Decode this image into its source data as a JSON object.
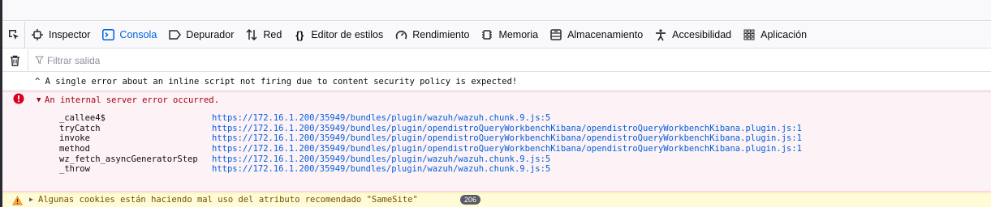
{
  "toolbar": {
    "tabs": [
      {
        "label": "Inspector",
        "icon": "inspector-icon"
      },
      {
        "label": "Consola",
        "icon": "console-icon",
        "active": true
      },
      {
        "label": "Depurador",
        "icon": "debugger-icon"
      },
      {
        "label": "Red",
        "icon": "network-icon"
      },
      {
        "label": "Editor de estilos",
        "icon": "style-editor-icon"
      },
      {
        "label": "Rendimiento",
        "icon": "performance-icon"
      },
      {
        "label": "Memoria",
        "icon": "memory-icon"
      },
      {
        "label": "Almacenamiento",
        "icon": "storage-icon"
      },
      {
        "label": "Accesibilidad",
        "icon": "accessibility-icon"
      },
      {
        "label": "Aplicación",
        "icon": "application-icon"
      }
    ],
    "active_color": "#0061e0"
  },
  "filter": {
    "placeholder": "Filtrar salida"
  },
  "messages": {
    "info": "^ A single error about an inline script not firing due to content security policy is expected!",
    "error": {
      "text": "An internal server error occurred.",
      "color": "#a4000f",
      "stack": [
        {
          "fn": "_callee4$",
          "loc": "https://172.16.1.200/35949/bundles/plugin/wazuh/wazuh.chunk.9.js:5"
        },
        {
          "fn": "tryCatch",
          "loc": "https://172.16.1.200/35949/bundles/plugin/opendistroQueryWorkbenchKibana/opendistroQueryWorkbenchKibana.plugin.js:1"
        },
        {
          "fn": "invoke",
          "loc": "https://172.16.1.200/35949/bundles/plugin/opendistroQueryWorkbenchKibana/opendistroQueryWorkbenchKibana.plugin.js:1"
        },
        {
          "fn": "method",
          "loc": "https://172.16.1.200/35949/bundles/plugin/opendistroQueryWorkbenchKibana/opendistroQueryWorkbenchKibana.plugin.js:1"
        },
        {
          "fn": "wz_fetch_asyncGeneratorStep",
          "loc": "https://172.16.1.200/35949/bundles/plugin/wazuh/wazuh.chunk.9.js:5"
        },
        {
          "fn": "_throw",
          "loc": "https://172.16.1.200/35949/bundles/plugin/wazuh/wazuh.chunk.9.js:5"
        }
      ]
    },
    "warning": {
      "text": "Algunas cookies están haciendo mal uso del atributo recomendado  \"SameSite\"",
      "count": "206"
    }
  }
}
